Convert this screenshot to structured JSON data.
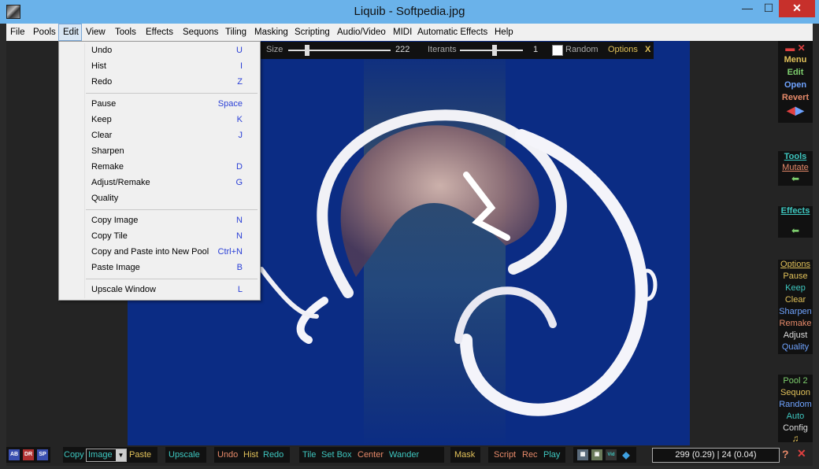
{
  "window": {
    "title": "Liquib - Softpedia.jpg",
    "minimize": "—",
    "maximize": "☐",
    "close": "✕"
  },
  "menubar": [
    "File",
    "Pools",
    "Edit",
    "View",
    "Tools",
    "Effects",
    "Sequons",
    "Tiling",
    "Masking",
    "Scripting",
    "Audio/Video",
    "MIDI",
    "Automatic Effects",
    "Help"
  ],
  "edit_menu": [
    {
      "label": "Undo",
      "key": "U"
    },
    {
      "label": "Hist",
      "key": "I"
    },
    {
      "label": "Redo",
      "key": "Z"
    },
    {
      "label": "Pause",
      "key": "Space"
    },
    {
      "label": "Keep",
      "key": "K"
    },
    {
      "label": "Clear",
      "key": "J"
    },
    {
      "label": "Sharpen",
      "key": ""
    },
    {
      "label": "Remake",
      "key": "D"
    },
    {
      "label": "Adjust/Remake",
      "key": "G"
    },
    {
      "label": "Quality",
      "key": ""
    },
    {
      "label": "Copy Image",
      "key": "N"
    },
    {
      "label": "Copy Tile",
      "key": "N"
    },
    {
      "label": "Copy and Paste into New Pool",
      "key": "Ctrl+N"
    },
    {
      "label": "Paste Image",
      "key": "B"
    },
    {
      "label": "Upscale Window",
      "key": "L"
    }
  ],
  "topstrip": {
    "size_label": "Size",
    "size_value": "222",
    "size_fraction": 0.17,
    "iterants_label": "Iterants",
    "iterants_value": "1",
    "iterants_fraction": 0.55,
    "random_label": "Random",
    "options_label": "Options",
    "close_label": "X"
  },
  "rightpanel": {
    "menu": "Menu",
    "edit": "Edit",
    "open": "Open",
    "revert": "Revert",
    "tools": "Tools",
    "mutate": "Mutate",
    "effects": "Effects",
    "options": "Options",
    "pause": "Pause",
    "keep": "Keep",
    "clear": "Clear",
    "sharpen": "Sharpen",
    "remake": "Remake",
    "adjust": "Adjust",
    "quality": "Quality",
    "pool": "Pool 2",
    "sequon": "Sequon",
    "random": "Random",
    "auto": "Auto",
    "config": "Config"
  },
  "bottombar": {
    "copy": "Copy",
    "image_select": "Image",
    "paste": "Paste",
    "upscale": "Upscale",
    "undo": "Undo",
    "hist": "Hist",
    "redo": "Redo",
    "tile": "Tile",
    "set_box": "Set Box",
    "center": "Center",
    "wander": "Wander",
    "mask": "Mask",
    "script": "Script",
    "rec": "Rec",
    "play": "Play",
    "readout": "299 (0.29) | 24 (0.04)",
    "help": "?"
  },
  "colors": {
    "canvas": "#0b2c84",
    "gold": "#e2c25a",
    "teal": "#3ec7c0",
    "salmon": "#e78a6a",
    "green": "#7ecf6e",
    "blue": "#6fa3ff"
  }
}
